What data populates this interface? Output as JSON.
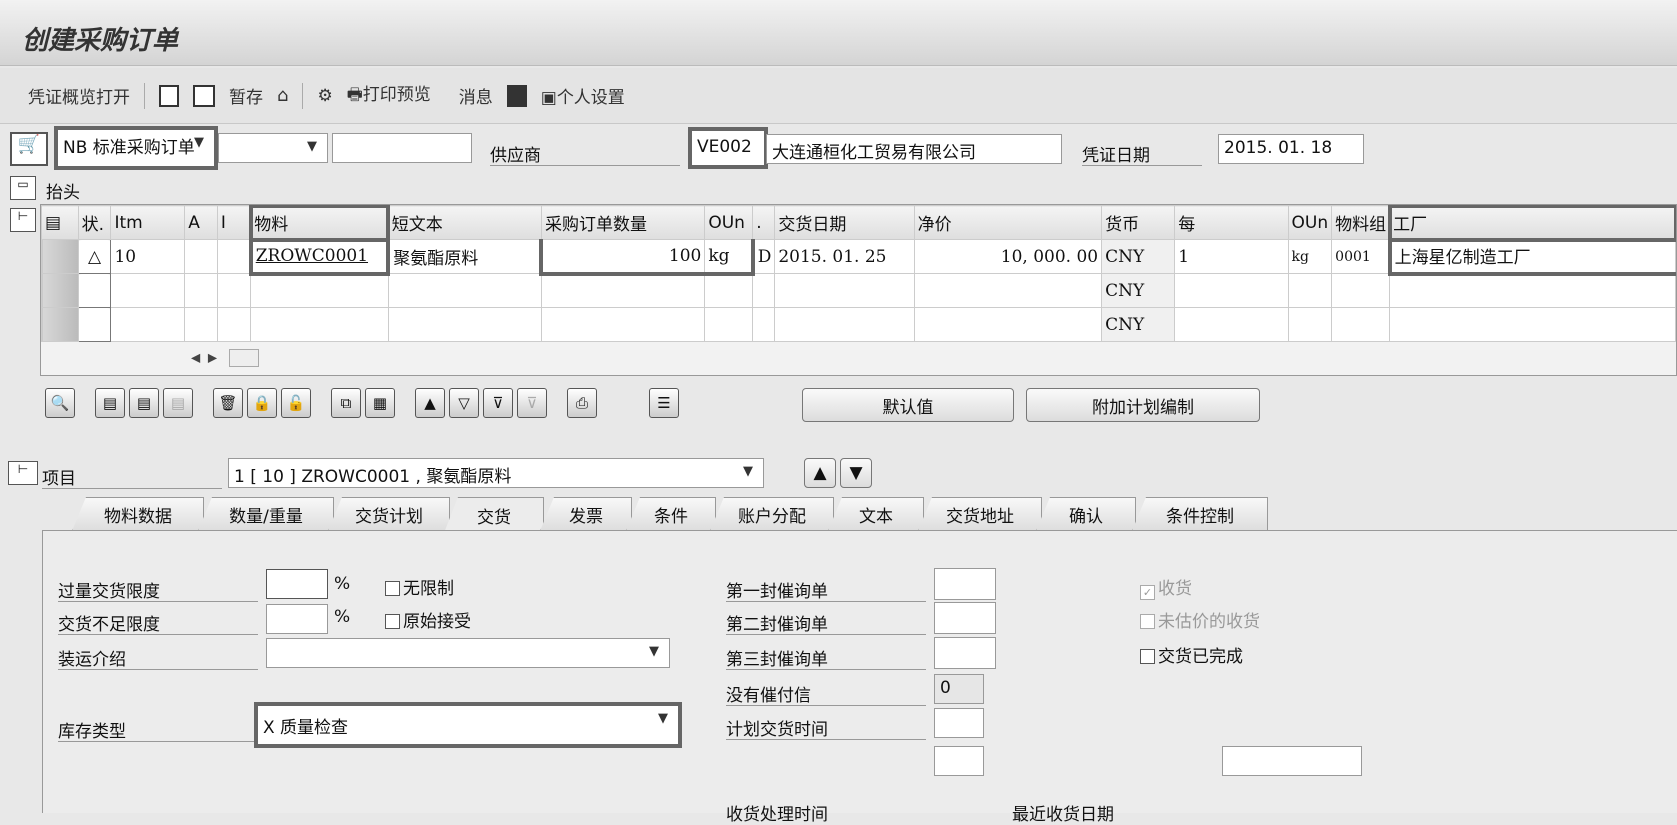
{
  "title": "创建采购订单",
  "toolbar": {
    "overview": "凭证概览打开",
    "hold": "暂存",
    "print_preview": "打印预览",
    "messages": "消息",
    "personal": "个人设置"
  },
  "header": {
    "doc_type": "NB 标准采购订单",
    "vendor_label": "供应商",
    "vendor_code": "VE002",
    "vendor_name": "大连通桓化工贸易有限公司",
    "doc_date_label": "凭证日期",
    "doc_date": "2015. 01. 18",
    "header_label": "抬头"
  },
  "grid": {
    "columns": [
      "状.",
      "Itm",
      "A",
      "I",
      "物料",
      "短文本",
      "采购订单数量",
      "OUn",
      ".",
      "交货日期",
      "净价",
      "货币",
      "每",
      "OUn",
      "物料组",
      "工厂"
    ],
    "rows": [
      {
        "status": "△",
        "itm": "10",
        "material": "ZROWC0001",
        "short_text": "聚氨酯原料",
        "qty": "100",
        "oun": "kg",
        "cat": "D",
        "date": "2015. 01. 25",
        "price": "10, 000. 00",
        "currency": "CNY",
        "per": "1",
        "oun2": "kg",
        "matgrp": "0001",
        "plant": "上海星亿制造工厂"
      },
      {
        "currency": "CNY"
      },
      {
        "currency": "CNY"
      }
    ]
  },
  "buttons": {
    "defaults": "默认值",
    "addl_planning": "附加计划编制"
  },
  "item": {
    "label": "项目",
    "value": "1 [ 10 ] ZROWC0001 , 聚氨酯原料"
  },
  "tabs": [
    "物料数据",
    "数量/重量",
    "交货计划",
    "交货",
    "发票",
    "条件",
    "账户分配",
    "文本",
    "交货地址",
    "确认",
    "条件控制"
  ],
  "delivery": {
    "overdeliv": "过量交货限度",
    "underdeliv": "交货不足限度",
    "pct": "%",
    "unlimited": "无限制",
    "orig_accept": "原始接受",
    "shipping": "装运介绍",
    "stock_type_label": "库存类型",
    "stock_type": "X 质量检查",
    "reminder1": "第一封催询单",
    "reminder2": "第二封催询单",
    "reminder3": "第三封催询单",
    "no_reminders": "没有催付信",
    "no_reminders_val": "0",
    "planned_deliv": "计划交货时间",
    "gr_proc_time": "收货处理时间",
    "last_gr_date": "最近收货日期",
    "gr": "收货",
    "nonval_gr": "未估价的收货",
    "deliv_complete": "交货已完成"
  }
}
